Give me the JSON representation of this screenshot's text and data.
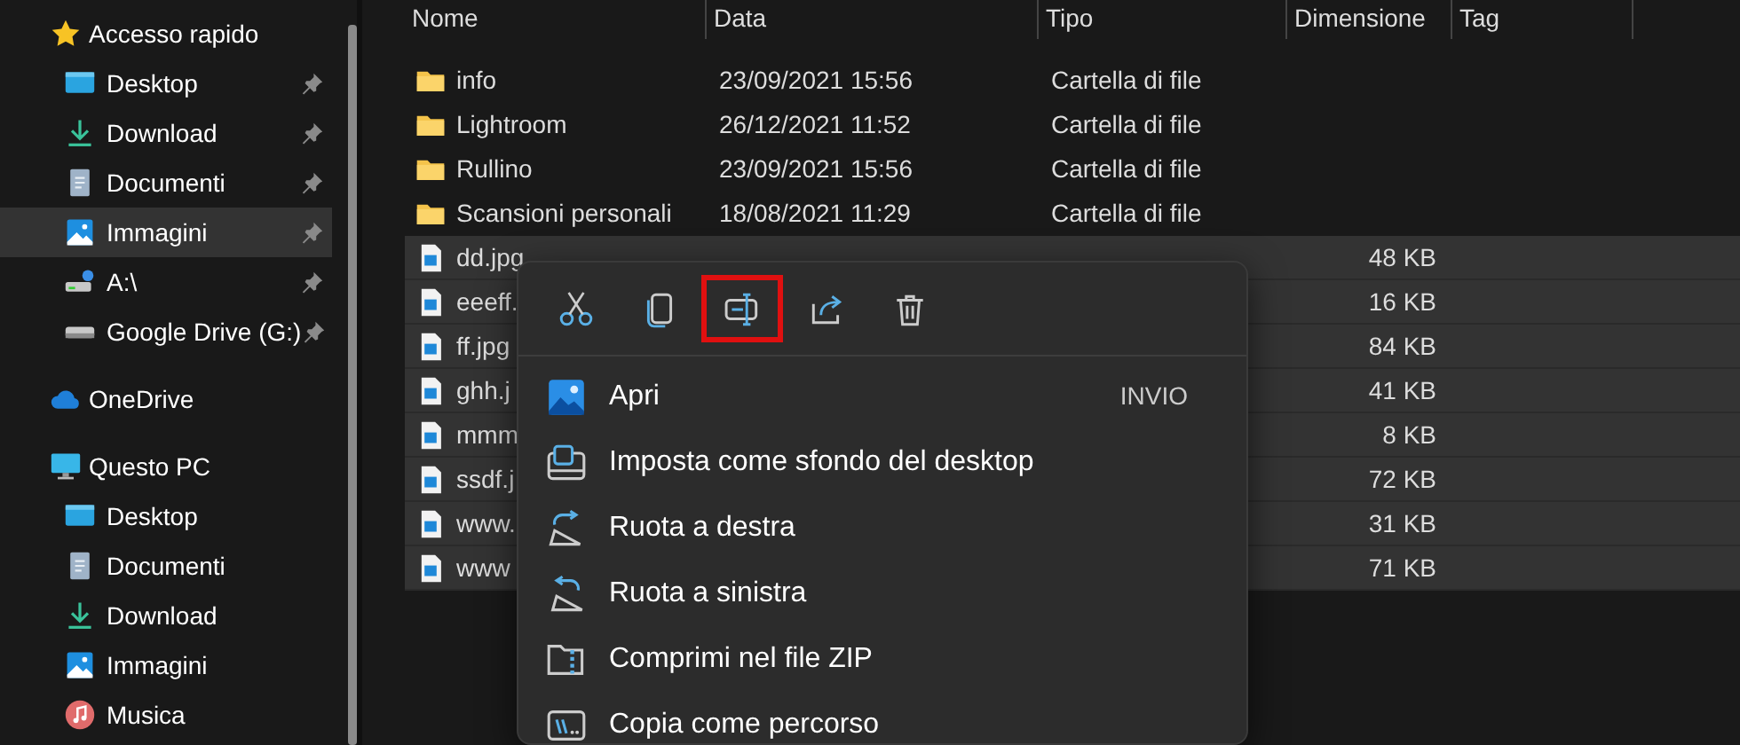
{
  "sidebar": {
    "items": [
      {
        "label": "Accesso rapido",
        "kind": "star",
        "selected": false,
        "children": [
          {
            "label": "Desktop",
            "kind": "desktop",
            "pinned": true,
            "selected": false
          },
          {
            "label": "Download",
            "kind": "download",
            "pinned": true,
            "selected": false
          },
          {
            "label": "Documenti",
            "kind": "document",
            "pinned": true,
            "selected": false
          },
          {
            "label": "Immagini",
            "kind": "pictures",
            "pinned": true,
            "selected": true
          },
          {
            "label": "A:\\",
            "kind": "netdrive",
            "pinned": true,
            "selected": false
          },
          {
            "label": "Google Drive (G:)",
            "kind": "drive",
            "pinned": true,
            "selected": false
          }
        ]
      },
      {
        "label": "OneDrive",
        "kind": "cloud",
        "selected": false
      },
      {
        "label": "Questo PC",
        "kind": "pc",
        "selected": false,
        "children": [
          {
            "label": "Desktop",
            "kind": "desktop",
            "pinned": false,
            "selected": false
          },
          {
            "label": "Documenti",
            "kind": "document",
            "pinned": false,
            "selected": false
          },
          {
            "label": "Download",
            "kind": "download",
            "pinned": false,
            "selected": false
          },
          {
            "label": "Immagini",
            "kind": "pictures",
            "pinned": false,
            "selected": false
          },
          {
            "label": "Musica",
            "kind": "music",
            "pinned": false,
            "selected": false
          }
        ]
      }
    ]
  },
  "table": {
    "columns": [
      "Nome",
      "Data",
      "Tipo",
      "Dimensione",
      "Tag"
    ],
    "rows": [
      {
        "kind": "folder",
        "name": "info",
        "date": "23/09/2021 15:56",
        "type": "Cartella di file",
        "selected": false
      },
      {
        "kind": "folder",
        "name": "Lightroom",
        "date": "26/12/2021 11:52",
        "type": "Cartella di file",
        "selected": false
      },
      {
        "kind": "folder",
        "name": "Rullino",
        "date": "23/09/2021 15:56",
        "type": "Cartella di file",
        "selected": false
      },
      {
        "kind": "folder",
        "name": "Scansioni personali",
        "date": "18/08/2021 11:29",
        "type": "Cartella di file",
        "selected": false
      },
      {
        "kind": "image",
        "name": "dd.jpg",
        "size": "48 KB",
        "selected": true
      },
      {
        "kind": "image",
        "name": "eeeff.",
        "size": "16 KB",
        "selected": true
      },
      {
        "kind": "image",
        "name": "ff.jpg",
        "size": "84 KB",
        "selected": true
      },
      {
        "kind": "image",
        "name": "ghh.j",
        "size": "41 KB",
        "selected": true
      },
      {
        "kind": "image",
        "name": "mmm",
        "size": "8 KB",
        "selected": true
      },
      {
        "kind": "image",
        "name": "ssdf.j",
        "size": "72 KB",
        "selected": true
      },
      {
        "kind": "image",
        "name": "www.",
        "size": "31 KB",
        "selected": true
      },
      {
        "kind": "image",
        "name": "www",
        "size": "71 KB",
        "selected": true
      }
    ]
  },
  "context_menu": {
    "toolbar": [
      {
        "kind": "cut",
        "highlighted": false
      },
      {
        "kind": "copy",
        "highlighted": false
      },
      {
        "kind": "rename",
        "highlighted": true
      },
      {
        "kind": "share",
        "highlighted": false
      },
      {
        "kind": "delete",
        "highlighted": false
      }
    ],
    "items": [
      {
        "kind": "open",
        "label": "Apri",
        "shortcut": "INVIO"
      },
      {
        "kind": "wallpaper",
        "label": "Imposta come sfondo del desktop"
      },
      {
        "kind": "rotate-right",
        "label": "Ruota a destra"
      },
      {
        "kind": "rotate-left",
        "label": "Ruota a sinistra"
      },
      {
        "kind": "zip",
        "label": "Comprimi nel file ZIP"
      },
      {
        "kind": "path",
        "label": "Copia come percorso"
      }
    ]
  }
}
